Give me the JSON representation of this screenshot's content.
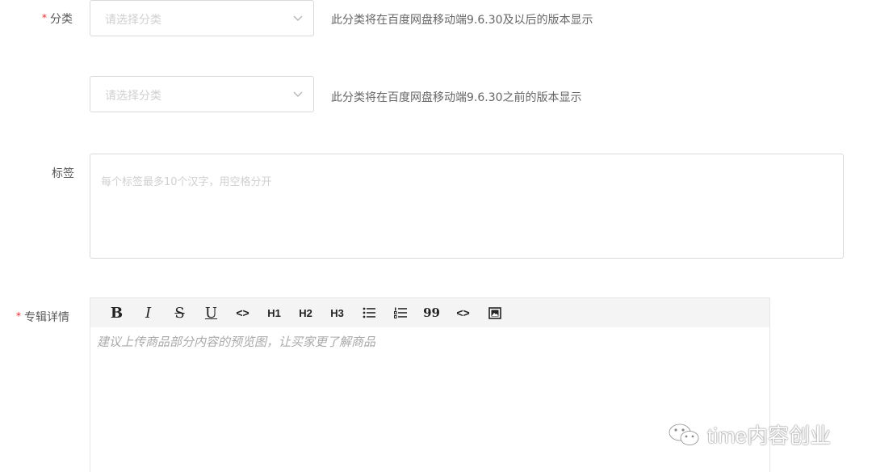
{
  "category_primary": {
    "required_mark": "*",
    "label": "分类",
    "placeholder": "请选择分类",
    "hint": "此分类将在百度网盘移动端9.6.30及以后的版本显示"
  },
  "category_secondary": {
    "placeholder": "请选择分类",
    "hint": "此分类将在百度网盘移动端9.6.30之前的版本显示"
  },
  "tags": {
    "label": "标签",
    "placeholder": "每个标签最多10个汉字，用空格分开"
  },
  "details": {
    "required_mark": "*",
    "label": "专辑详情",
    "placeholder": "建议上传商品部分内容的预览图，让买家更了解商品",
    "toolbar": [
      {
        "name": "bold",
        "label": "B"
      },
      {
        "name": "italic",
        "label": "I"
      },
      {
        "name": "strikethrough",
        "label": "S"
      },
      {
        "name": "underline",
        "label": "U"
      },
      {
        "name": "code",
        "label": "<>"
      },
      {
        "name": "h1",
        "label": "H1"
      },
      {
        "name": "h2",
        "label": "H2"
      },
      {
        "name": "h3",
        "label": "H3"
      },
      {
        "name": "bullet-list",
        "label": ""
      },
      {
        "name": "ordered-list",
        "label": ""
      },
      {
        "name": "quote",
        "label": "99"
      },
      {
        "name": "code-block",
        "label": "<>"
      },
      {
        "name": "image",
        "label": ""
      }
    ]
  },
  "watermark": {
    "text": "time内容创业"
  },
  "colors": {
    "required": "#f5222d",
    "border": "#d9d9d9",
    "placeholder": "#d0d0d0",
    "toolbar_bg": "#f4f4f4"
  }
}
